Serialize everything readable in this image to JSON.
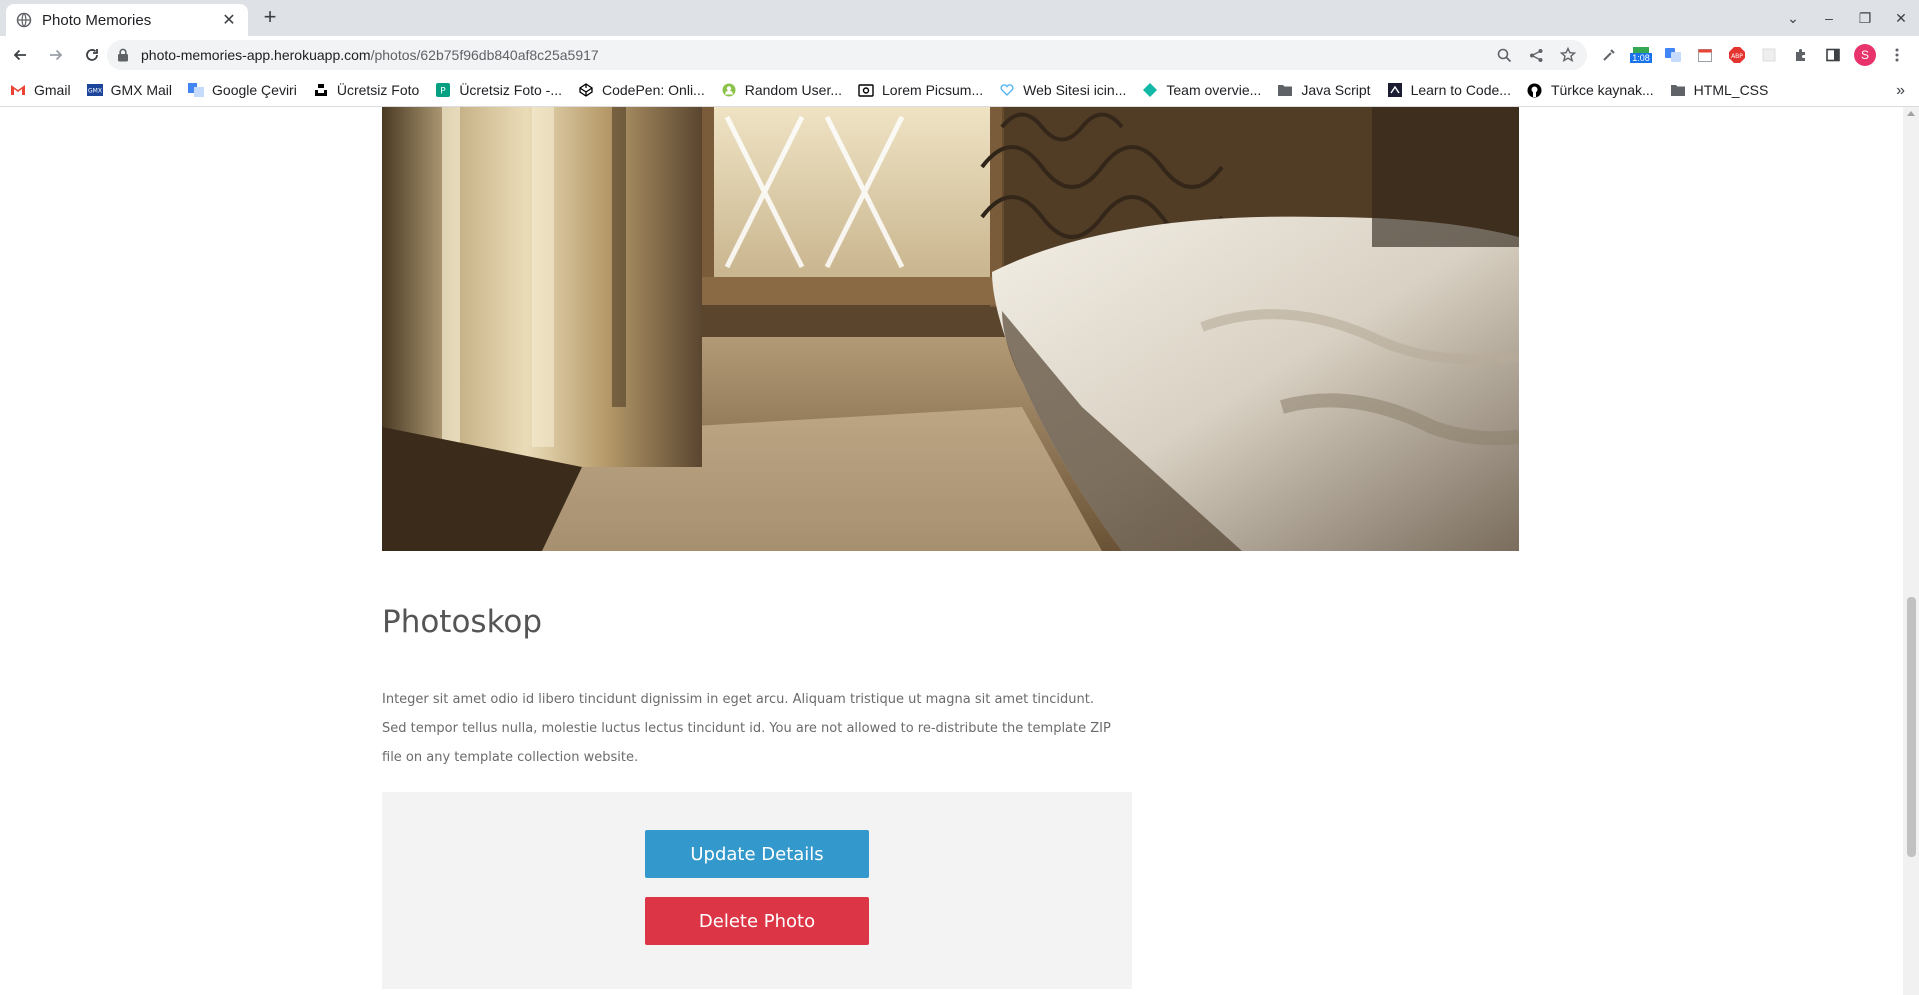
{
  "browser": {
    "tab": {
      "title": "Photo Memories",
      "close_glyph": "✕",
      "favicon": "globe-icon"
    },
    "new_tab_glyph": "+",
    "window_controls": [
      "⌄",
      "–",
      "❐",
      "✕"
    ],
    "url": {
      "domain": "photo-memories-app.herokuapp.com",
      "path": "/photos/62b75f96db840af8c25a5917"
    },
    "extension_badge": "1:08",
    "profile_initial": "S",
    "bookmarks": [
      {
        "label": "Gmail",
        "icon": "gmail-icon"
      },
      {
        "label": "GMX Mail",
        "icon": "gmx-icon"
      },
      {
        "label": "Google Çeviri",
        "icon": "translate-icon"
      },
      {
        "label": "Ücretsiz Foto",
        "icon": "unsplash-icon"
      },
      {
        "label": "Ücretsiz Foto -...",
        "icon": "photo-site-icon"
      },
      {
        "label": "CodePen: Onli...",
        "icon": "codepen-icon"
      },
      {
        "label": "Random User...",
        "icon": "random-user-icon"
      },
      {
        "label": "Lorem Picsum...",
        "icon": "picsum-icon"
      },
      {
        "label": "Web Sitesi icin...",
        "icon": "heart-icon"
      },
      {
        "label": "Team overvie...",
        "icon": "diamond-icon"
      },
      {
        "label": "Java Script",
        "icon": "folder-icon"
      },
      {
        "label": "Learn to Code...",
        "icon": "learn-icon"
      },
      {
        "label": "Türkce kaynak...",
        "icon": "github-icon"
      },
      {
        "label": "HTML_CSS",
        "icon": "folder-icon"
      }
    ],
    "bookmarks_more": "»"
  },
  "photo": {
    "title": "Photoskop",
    "description": "Integer sit amet odio id libero tincidunt dignissim in eget arcu. Aliquam tristique ut magna sit amet tincidunt. Sed tempor tellus nulla, molestie luctus lectus tincidunt id. You are not allowed to re-distribute the template ZIP file on any template collection website."
  },
  "actions": {
    "update_label": "Update Details",
    "delete_label": "Delete Photo"
  },
  "colors": {
    "update_button": "#3399cc",
    "delete_button": "#dc3545",
    "actions_panel": "#f3f3f3"
  }
}
